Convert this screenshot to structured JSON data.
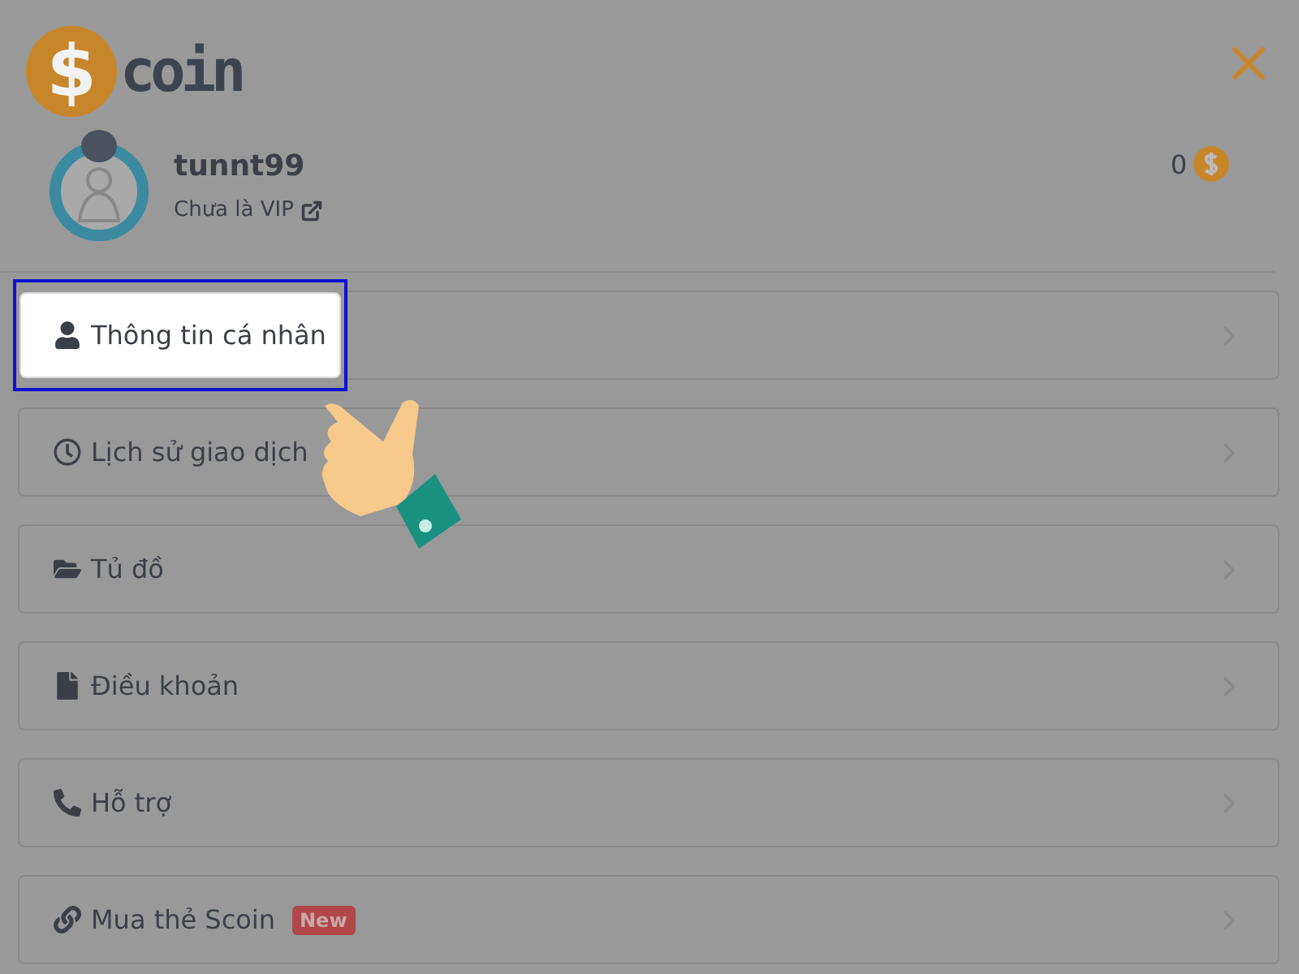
{
  "logo": {
    "symbol": "$",
    "text": "coin"
  },
  "profile": {
    "username": "tunnt99",
    "vip_status": "Chưa là VIP",
    "balance": "0"
  },
  "menu": [
    {
      "label": "Thông tin cá nhân",
      "highlighted": true
    },
    {
      "label": "Lịch sử giao dịch",
      "highlighted": false
    },
    {
      "label": "Tủ đồ",
      "highlighted": false
    },
    {
      "label": "Điều khoản",
      "highlighted": false
    },
    {
      "label": "Hỗ trợ",
      "highlighted": false
    },
    {
      "label": "Mua thẻ Scoin",
      "badge": "New",
      "highlighted": false
    }
  ]
}
